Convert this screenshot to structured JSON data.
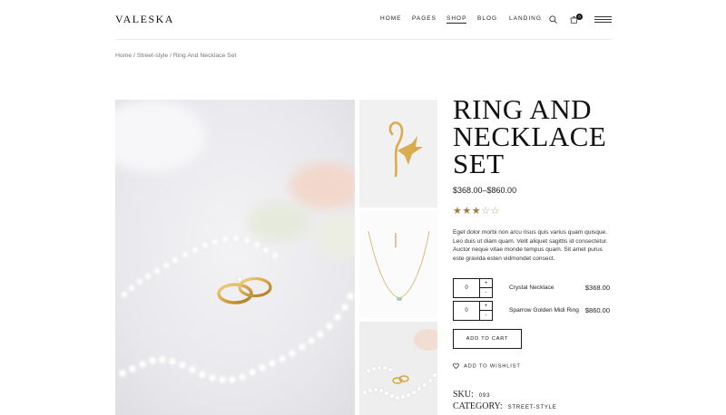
{
  "header": {
    "logo": "VALESKA",
    "nav": [
      "HOME",
      "PAGES",
      "SHOP",
      "BLOG",
      "LANDING"
    ],
    "active_nav": "SHOP",
    "cart_count": "0",
    "icons": [
      "search-icon",
      "cart-icon",
      "menu-icon"
    ]
  },
  "breadcrumb": {
    "home": "Home",
    "category": "Street-style",
    "current": "Ring And Necklace Set",
    "separator": "/"
  },
  "product": {
    "title": "RING AND NECKLACE SET",
    "price_range": "$368.00–$860.00",
    "rating": 3,
    "rating_max": 5,
    "description": "Eget dolor morbi non arcu risus quis varius quam quisque. Leo duis ut diam quam. Velit aliquet sagittis id consectetur. Auctor neque vitae monde tempus quam. Sit amet purus este gravida esten vidmondet consect.",
    "items": [
      {
        "qty": "0",
        "name": "Crystal Necklace",
        "price": "$368.00"
      },
      {
        "qty": "0",
        "name": "Sparrow Golden Midi Ring",
        "price": "$860.00"
      }
    ],
    "add_to_cart": "ADD TO CART",
    "wishlist": "ADD TO WISHLIST",
    "sku_label": "SKU:",
    "sku_value": "093",
    "category_label": "CATEGORY:",
    "category_value": "STREET-STYLE",
    "qty_plus": "+",
    "qty_minus": "-"
  },
  "colors": {
    "accent": "#9c7d3f",
    "text": "#1a1a1a",
    "gold": "#d9ac4e"
  }
}
